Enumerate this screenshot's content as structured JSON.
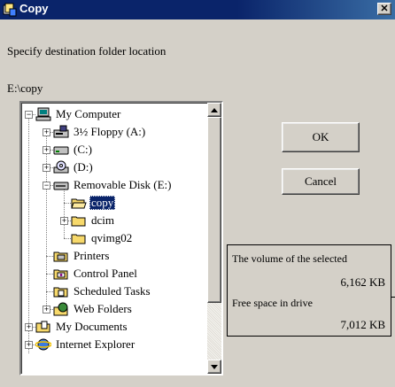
{
  "window": {
    "title": "Copy",
    "close_glyph": "✕"
  },
  "prompt": "Specify destination folder location",
  "path": "E:\\copy",
  "tree": {
    "items": [
      {
        "label": "My Computer",
        "icon": "computer-icon",
        "expander": "−"
      },
      {
        "label": "3½ Floppy (A:)",
        "icon": "floppy-drive-icon",
        "expander": "+"
      },
      {
        "label": "(C:)",
        "icon": "hard-drive-icon",
        "expander": "+"
      },
      {
        "label": "(D:)",
        "icon": "cd-drive-icon",
        "expander": "+"
      },
      {
        "label": "Removable Disk (E:)",
        "icon": "removable-disk-icon",
        "expander": "−"
      },
      {
        "label": "copy",
        "icon": "folder-open-icon",
        "selected": true
      },
      {
        "label": "dcim",
        "icon": "folder-icon",
        "expander": "+"
      },
      {
        "label": "qvimg02",
        "icon": "folder-icon"
      },
      {
        "label": "Printers",
        "icon": "printer-folder-icon"
      },
      {
        "label": "Control Panel",
        "icon": "control-panel-icon"
      },
      {
        "label": "Scheduled Tasks",
        "icon": "scheduled-tasks-icon"
      },
      {
        "label": "Web Folders",
        "icon": "web-folders-icon",
        "expander": "+"
      },
      {
        "label": "My Documents",
        "icon": "my-documents-icon",
        "expander": "+"
      },
      {
        "label": "Internet Explorer",
        "icon": "internet-explorer-icon",
        "expander": "+"
      }
    ]
  },
  "buttons": {
    "ok": "OK",
    "cancel": "Cancel"
  },
  "info": {
    "volume_label": "The volume of the selected",
    "volume_value": "6,162  KB",
    "free_label": "Free space in drive",
    "free_value": "7,012  KB"
  },
  "colors": {
    "titlebar": "#0a246a",
    "selection": "#0a246a",
    "face": "#d4d0c8",
    "folder": "#f7d96b"
  }
}
